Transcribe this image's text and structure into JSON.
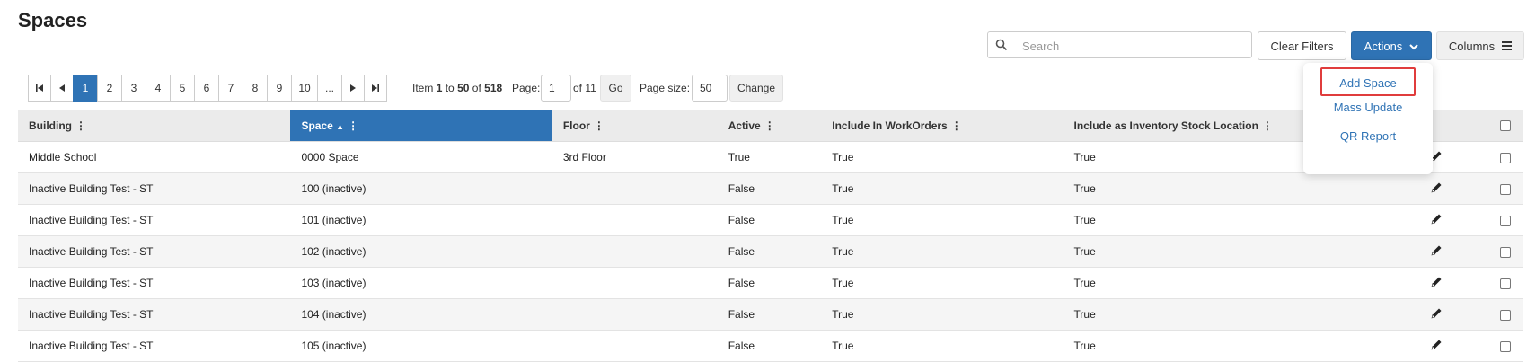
{
  "page": {
    "title": "Spaces"
  },
  "toolbar": {
    "search_placeholder": "Search",
    "clear_filters_label": "Clear Filters",
    "actions_label": "Actions",
    "columns_label": "Columns"
  },
  "actions_menu": {
    "items": [
      {
        "label": "Add Space"
      },
      {
        "label": "Mass Update"
      },
      {
        "label": "QR Report"
      }
    ]
  },
  "pagination": {
    "pages": [
      "1",
      "2",
      "3",
      "4",
      "5",
      "6",
      "7",
      "8",
      "9",
      "10",
      "..."
    ],
    "current_page": "1",
    "item_label": "Item",
    "item_from": "1",
    "to_label": "to",
    "item_to": "50",
    "of_label": "of",
    "item_total": "518",
    "page_label": "Page:",
    "page_value": "1",
    "of_pages": "of 11",
    "go_label": "Go",
    "page_size_label": "Page size:",
    "page_size_value": "50",
    "change_label": "Change"
  },
  "table": {
    "columns": [
      "Building",
      "Space",
      "Floor",
      "Active",
      "Include In WorkOrders",
      "Include as Inventory Stock Location"
    ],
    "sort_indicator": "▲",
    "rows": [
      [
        "Middle School",
        "0000 Space",
        "3rd Floor",
        "True",
        "True",
        "True"
      ],
      [
        "Inactive Building Test - ST",
        "100 (inactive)",
        "",
        "False",
        "True",
        "True"
      ],
      [
        "Inactive Building Test - ST",
        "101 (inactive)",
        "",
        "False",
        "True",
        "True"
      ],
      [
        "Inactive Building Test - ST",
        "102 (inactive)",
        "",
        "False",
        "True",
        "True"
      ],
      [
        "Inactive Building Test - ST",
        "103 (inactive)",
        "",
        "False",
        "True",
        "True"
      ],
      [
        "Inactive Building Test - ST",
        "104 (inactive)",
        "",
        "False",
        "True",
        "True"
      ],
      [
        "Inactive Building Test - ST",
        "105 (inactive)",
        "",
        "False",
        "True",
        "True"
      ]
    ]
  },
  "colors": {
    "accent": "#2f73b5",
    "highlight_border": "#e03c3c",
    "header_bg": "#ebebeb"
  },
  "icons": {
    "search": "search-icon",
    "chevron": "chevron-down-icon",
    "columns": "hamburger-icon",
    "edit": "pencil-icon"
  }
}
